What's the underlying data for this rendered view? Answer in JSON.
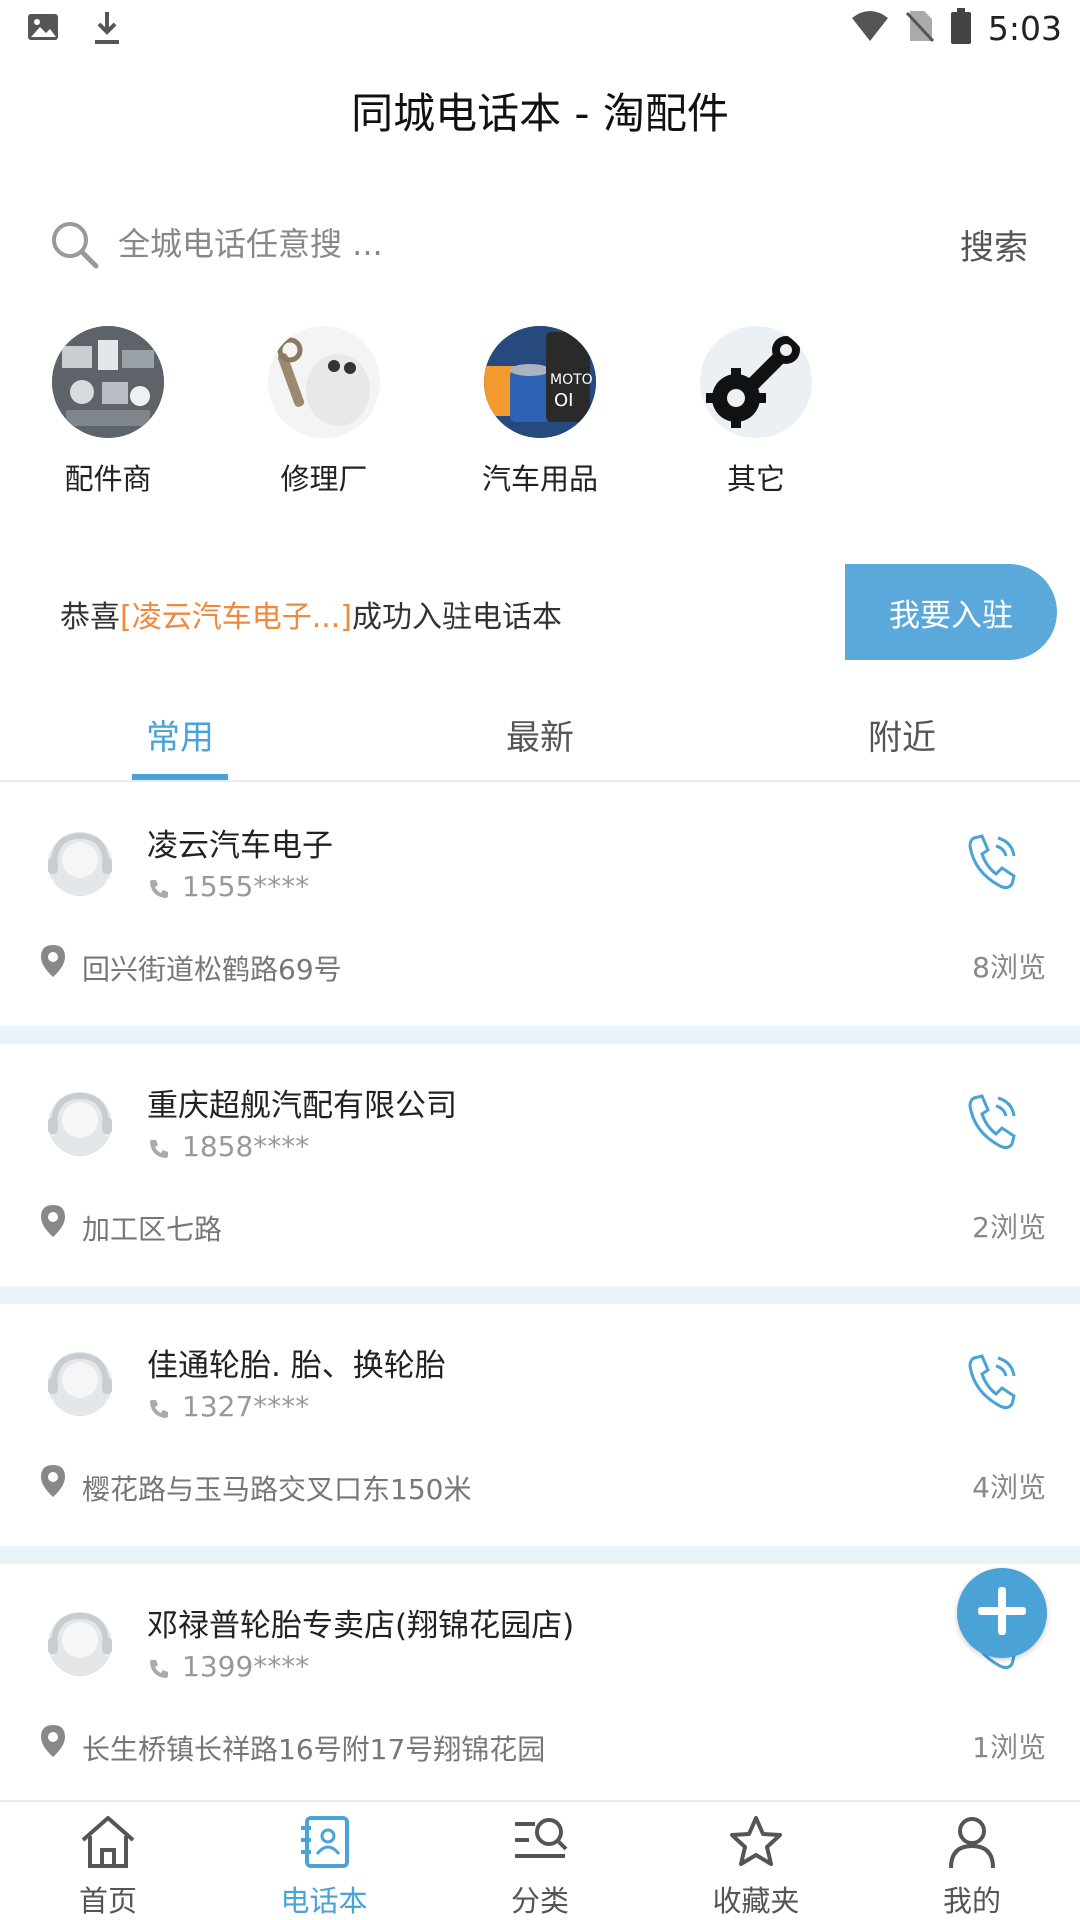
{
  "status_bar": {
    "time": "5:03"
  },
  "app": {
    "title": "同城电话本 - 淘配件"
  },
  "search": {
    "placeholder": "全城电话任意搜 ...",
    "value": "",
    "button_label": "搜索"
  },
  "categories": [
    {
      "label": "配件商",
      "icon": "parts-image"
    },
    {
      "label": "修理厂",
      "icon": "mechanic-image"
    },
    {
      "label": "汽车用品",
      "icon": "oil-filter-image"
    },
    {
      "label": "其它",
      "icon": "wrench-gear-icon"
    }
  ],
  "banner": {
    "prefix": "恭喜",
    "highlight": "[凌云汽车电子...]",
    "suffix": "成功入驻电话本",
    "join_button": "我要入驻"
  },
  "tabs": [
    {
      "label": "常用",
      "active": true
    },
    {
      "label": "最新",
      "active": false
    },
    {
      "label": "附近",
      "active": false
    }
  ],
  "listings": [
    {
      "name": "凌云汽车电子",
      "phone": "1555****",
      "address": "回兴街道松鹤路69号",
      "views": "8浏览"
    },
    {
      "name": "重庆超舰汽配有限公司",
      "phone": "1858****",
      "address": "加工区七路",
      "views": "2浏览"
    },
    {
      "name": "佳通轮胎. 胎、换轮胎",
      "phone": "1327****",
      "address": "樱花路与玉马路交叉口东150米",
      "views": "4浏览"
    },
    {
      "name": "邓禄普轮胎专卖店(翔锦花园店)",
      "phone": "1399****",
      "address": "长生桥镇长祥路16号附17号翔锦花园",
      "views": "1浏览"
    }
  ],
  "bottom_nav": [
    {
      "label": "首页",
      "icon": "home-icon",
      "active": false
    },
    {
      "label": "电话本",
      "icon": "contacts-icon",
      "active": true
    },
    {
      "label": "分类",
      "icon": "category-search-icon",
      "active": false
    },
    {
      "label": "收藏夹",
      "icon": "star-icon",
      "active": false
    },
    {
      "label": "我的",
      "icon": "user-icon",
      "active": false
    }
  ],
  "colors": {
    "accent": "#4aa2d6",
    "highlight": "#f08a3c",
    "join_button": "#5aa9da",
    "separator": "#eaf3f7"
  }
}
